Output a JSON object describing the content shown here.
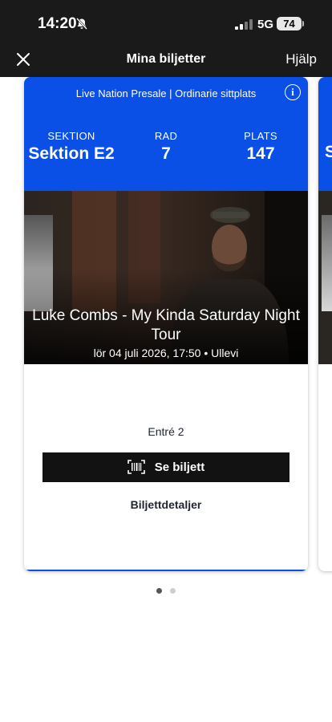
{
  "status_bar": {
    "time": "14:20",
    "network": "5G",
    "battery": "74"
  },
  "nav": {
    "title": "Mina biljetter",
    "help": "Hjälp"
  },
  "ticket": {
    "header": "Live Nation Presale | Ordinarie sittplats",
    "section_label": "SEKTION",
    "section_value": "Sektion E2",
    "row_label": "RAD",
    "row_value": "7",
    "seat_label": "PLATS",
    "seat_value": "147",
    "event_title": "Luke Combs - My Kinda Saturday Night Tour",
    "event_date": "lör 04 juli 2026, 17:50 • Ullevi",
    "entrance": "Entré 2",
    "view_ticket": "Se biljett",
    "ticket_details": "Biljettdetaljer"
  },
  "next_card": {
    "section_initial": "S"
  },
  "pager": {
    "count": 2,
    "active": 0
  },
  "colors": {
    "brand_blue": "#0a4fe6",
    "button_black": "#121212",
    "status_bg": "#1a1a1a"
  }
}
